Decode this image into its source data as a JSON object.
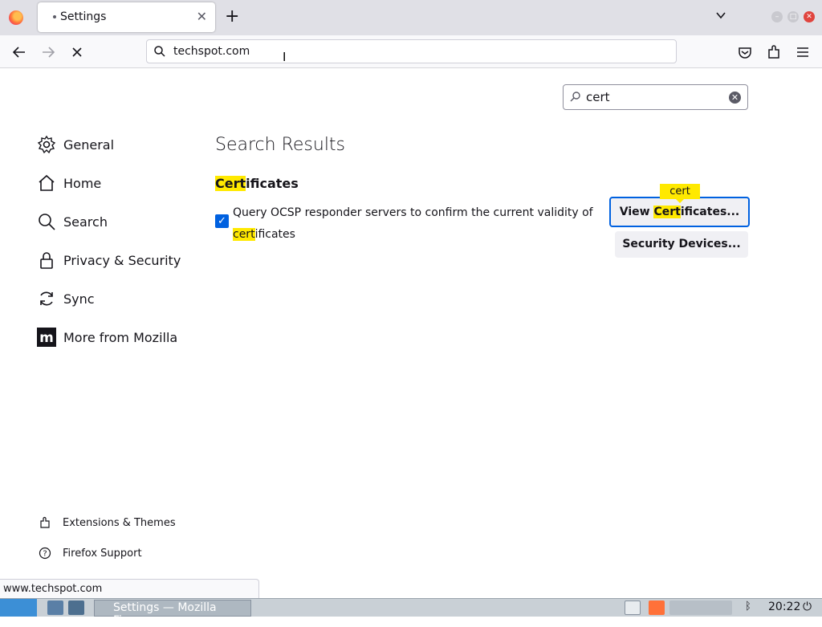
{
  "browser": {
    "tab_title": "Settings",
    "url": "techspot.com",
    "status_url": "www.techspot.com"
  },
  "settings": {
    "search_value": "cert",
    "nav": [
      {
        "label": "General",
        "icon": "gear-icon"
      },
      {
        "label": "Home",
        "icon": "home-icon"
      },
      {
        "label": "Search",
        "icon": "search-icon"
      },
      {
        "label": "Privacy & Security",
        "icon": "lock-icon"
      },
      {
        "label": "Sync",
        "icon": "sync-icon"
      },
      {
        "label": "More from Mozilla",
        "icon": "mozilla-icon"
      }
    ],
    "footer": [
      {
        "label": "Extensions & Themes",
        "icon": "puzzle-icon"
      },
      {
        "label": "Firefox Support",
        "icon": "help-icon"
      }
    ],
    "results_heading": "Search Results",
    "section": {
      "title_highlight": "Cert",
      "title_rest": "ificates",
      "checkbox_text": "Query OCSP responder servers to confirm the current validity of",
      "checkbox_highlight": "cert",
      "checkbox_rest": "ificates",
      "checkbox_checked": true
    },
    "buttons": {
      "view_pre": "View ",
      "view_highlight": "Cert",
      "view_post": "ificates...",
      "security": "Security Devices..."
    },
    "tooltip": "cert"
  },
  "taskbar": {
    "task_label": "Settings — Mozilla Fire...",
    "clock": "20:22"
  },
  "colors": {
    "accent": "#0061e0",
    "highlight": "#ffe900"
  }
}
